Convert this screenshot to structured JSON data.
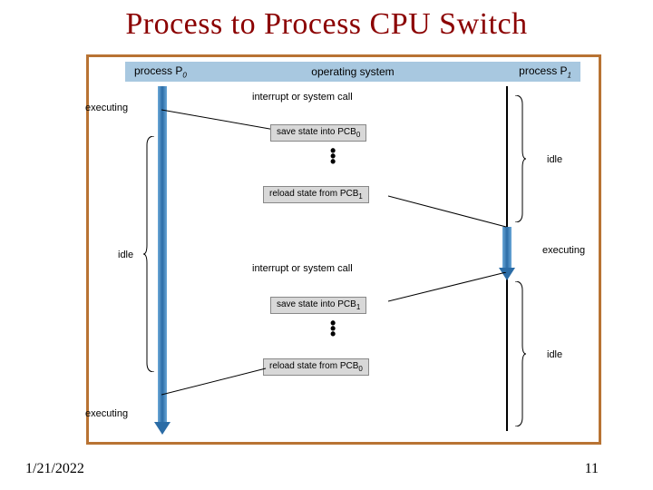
{
  "slide": {
    "title": "Process to Process CPU Switch",
    "date": "1/21/2022",
    "page": "11"
  },
  "header": {
    "p0": "process P",
    "p0_sub": "0",
    "os": "operating system",
    "p1": "process P",
    "p1_sub": "1"
  },
  "events": {
    "interrupt1": "interrupt or system call",
    "interrupt2": "interrupt or system call",
    "save0": "save state into PCB",
    "save0_sub": "0",
    "reload1": "reload state from PCB",
    "reload1_sub": "1",
    "save1": "save state into PCB",
    "save1_sub": "1",
    "reload0": "reload state from PCB",
    "reload0_sub": "0"
  },
  "status": {
    "exec": "executing",
    "idle": "idle"
  }
}
